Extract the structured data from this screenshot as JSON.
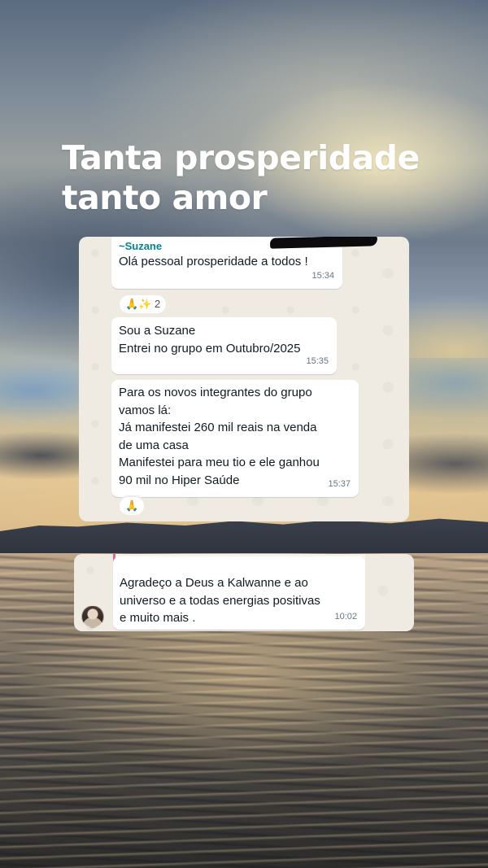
{
  "headline": {
    "line1": "Tanta prosperidade",
    "line2": "tanto amor"
  },
  "chat1": {
    "messages": [
      {
        "sender": "~Suzane",
        "lines": [
          "Olá pessoal prosperidade a todos !"
        ],
        "time": "15:34",
        "reaction": "🙏✨ 2"
      },
      {
        "lines": [
          "Sou a Suzane",
          "Entrei no grupo em Outubro/2025"
        ],
        "time": "15:35"
      },
      {
        "lines": [
          "Para os novos integrantes do grupo",
          "vamos lá:",
          "Já manifestei 260 mil reais na venda",
          "de uma casa",
          "Manifestei para meu tio e ele ganhou",
          "90 mil no Hiper Saúde"
        ],
        "time": "15:37",
        "reaction": "🙏"
      }
    ]
  },
  "chat2": {
    "message": {
      "lines": [
        "Agradeço a Deus a Kalwanne e ao",
        "universo e a todas energias positivas",
        "e muito mais ."
      ],
      "time": "10:02"
    }
  },
  "colors": {
    "chat_background": "#efeae2",
    "bubble": "#ffffff",
    "sender_name": "#06838f",
    "timestamp": "#667781"
  }
}
